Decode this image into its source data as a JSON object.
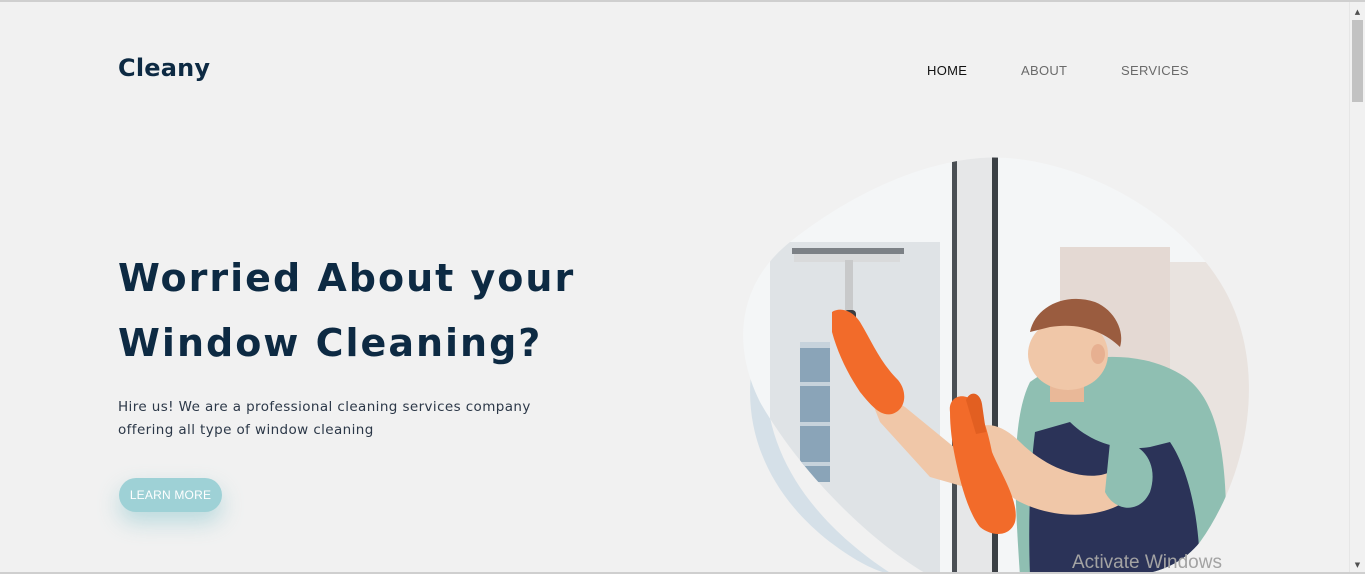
{
  "brand": {
    "logo": "Cleany"
  },
  "nav": {
    "items": [
      {
        "label": "HOME",
        "active": true
      },
      {
        "label": "ABOUT",
        "active": false
      },
      {
        "label": "SERVICES",
        "active": false
      }
    ]
  },
  "hero": {
    "headline_line1": "Worried About your",
    "headline_line2": "Window Cleaning?",
    "subtext_line1": "Hire us! We are a professional cleaning services company",
    "subtext_line2": "offering all type of window cleaning",
    "cta_label": "LEARN MORE",
    "image_alt": "window cleaner with squeegee and orange gloves"
  },
  "overlay": {
    "watermark": "Activate Windows"
  },
  "colors": {
    "background": "#f1f1f1",
    "heading": "#0d2a43",
    "accent": "#9ed1d6",
    "glove": "#f26b2a"
  }
}
